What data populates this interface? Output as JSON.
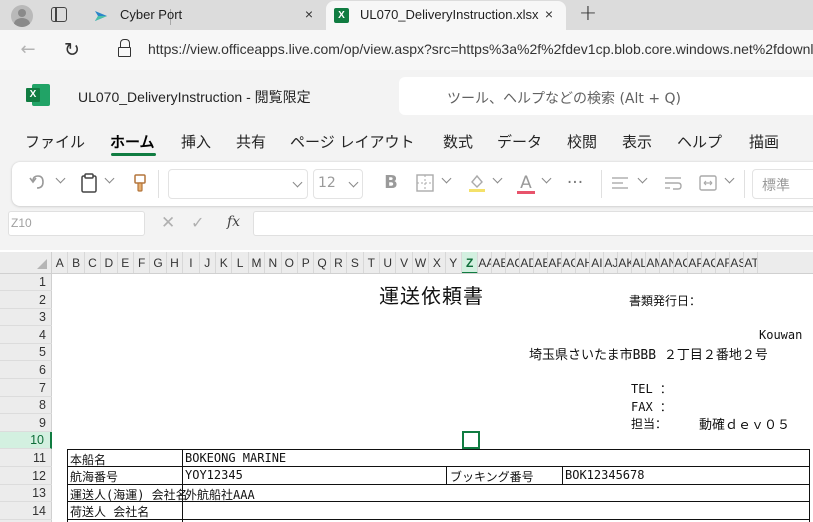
{
  "browser": {
    "tabs": [
      {
        "title": "Cyber Port",
        "close": "×"
      },
      {
        "title": "UL070_DeliveryInstruction.xlsx",
        "close": "×"
      }
    ],
    "new_tab": "+",
    "back": "←",
    "reload": "↻",
    "url": "https://view.officeapps.live.com/op/view.aspx?src=https%3a%2f%2fdev1cp.blob.core.windows.net%2fdownl"
  },
  "excel": {
    "logo": "X",
    "doc_title": "UL070_DeliveryInstruction  -  閲覧限定",
    "search_placeholder": "ツール、ヘルプなどの検索 (Alt + Q)",
    "ribbon_tabs": [
      "ファイル",
      "ホーム",
      "挿入",
      "共有",
      "ページ レイアウト",
      "数式",
      "データ",
      "校閲",
      "表示",
      "ヘルプ",
      "描画"
    ],
    "active_tab": "ホーム",
    "toolbar": {
      "font_size": "12",
      "bold": "B",
      "font_color": "A",
      "more": "···",
      "number_format": "標準"
    },
    "formula_bar": {
      "name_box": "Z10",
      "cancel": "✕",
      "enter": "✓",
      "fx": "fx",
      "formula": ""
    },
    "columns": [
      "A",
      "B",
      "C",
      "D",
      "E",
      "F",
      "G",
      "H",
      "I",
      "J",
      "K",
      "L",
      "M",
      "N",
      "O",
      "P",
      "Q",
      "R",
      "S",
      "T",
      "U",
      "V",
      "W",
      "X",
      "Y",
      "Z",
      "AA",
      "AB",
      "AC",
      "AD",
      "AE",
      "AF",
      "AG",
      "AH",
      "AI",
      "AJ",
      "AK",
      "AL",
      "AM",
      "AN",
      "AO",
      "AP",
      "AQ",
      "AR",
      "AS",
      "AT"
    ],
    "selected_column": "Z",
    "rows": [
      "1",
      "2",
      "3",
      "4",
      "5",
      "6",
      "7",
      "8",
      "9",
      "10",
      "11",
      "12",
      "13",
      "14"
    ],
    "selected_row": "10"
  },
  "sheet": {
    "title": "運送依頼書",
    "issue_date_label": "書類発行日：",
    "company": "Kouwan",
    "address": "埼玉県さいたま市BBB ２丁目２番地２号",
    "tel_label": "TEL ：",
    "fax_label": "FAX ：",
    "contact_label": "担当：",
    "contact_name": "動確ｄｅｖ０５",
    "table": {
      "vessel_label": "本船名",
      "vessel_value": "BOKEONG MARINE",
      "voyage_label": "航海番号",
      "voyage_value": "YOY12345",
      "booking_label": "ブッキング番号",
      "booking_value": "BOK12345678",
      "carrier_label": "運送人(海運) 会社名",
      "carrier_value": "外航船社AAA",
      "shipper_label": "荷送人 会社名",
      "shipper_value": ""
    }
  }
}
